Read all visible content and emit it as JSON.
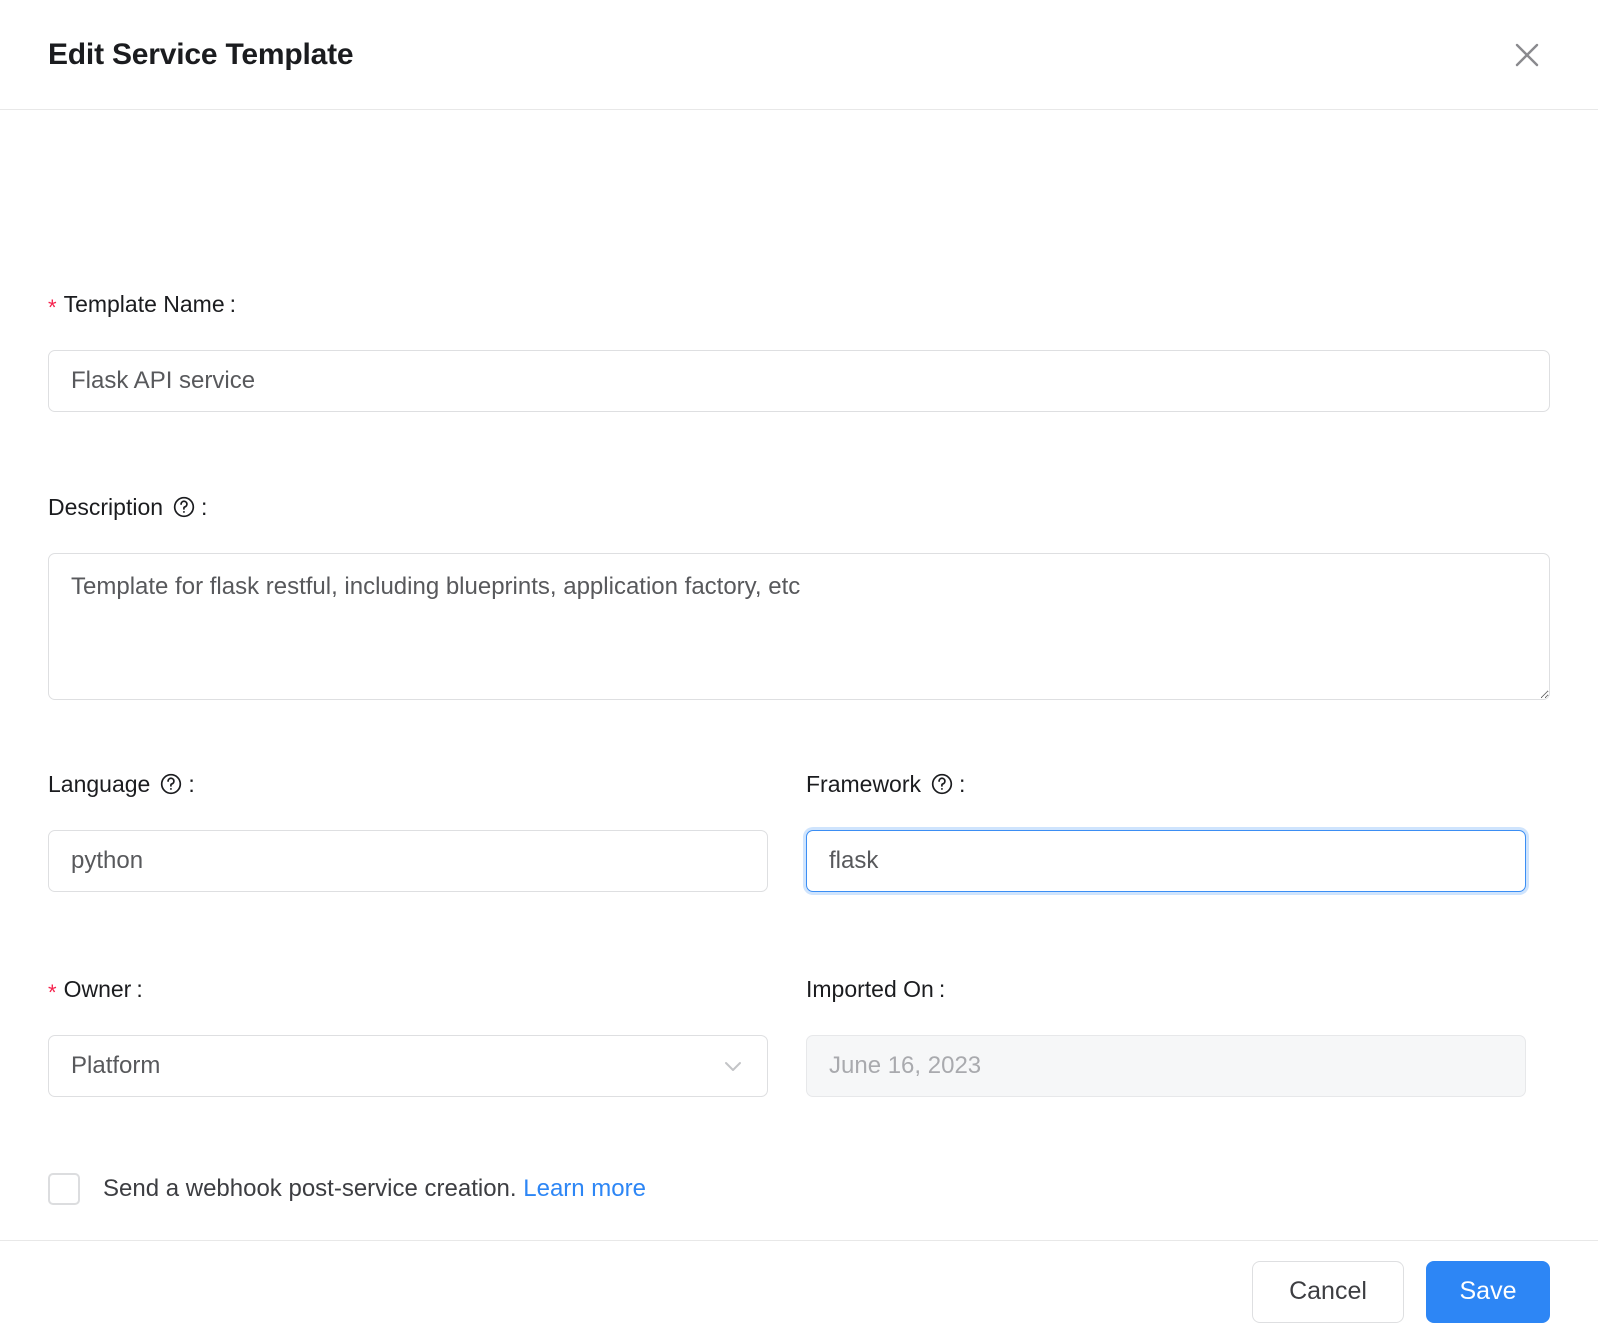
{
  "dialog": {
    "title": "Edit Service Template",
    "close_icon": "close-icon"
  },
  "fields": {
    "template_name": {
      "label": "Template Name",
      "required_marker": "*",
      "colon": ":",
      "value": "Flask API service"
    },
    "description": {
      "label": "Description",
      "help_icon": "question-circle-icon",
      "colon": ":",
      "value": "Template for flask restful, including blueprints, application factory, etc"
    },
    "language": {
      "label": "Language",
      "help_icon": "question-circle-icon",
      "colon": ":",
      "value": "python"
    },
    "framework": {
      "label": "Framework",
      "help_icon": "question-circle-icon",
      "colon": ":",
      "value": "flask",
      "focused": true
    },
    "owner": {
      "label": "Owner",
      "required_marker": "*",
      "colon": ":",
      "value": "Platform",
      "chevron_icon": "chevron-down-icon"
    },
    "imported_on": {
      "label": "Imported On",
      "colon": ":",
      "value": "June 16, 2023",
      "disabled": true
    }
  },
  "webhook": {
    "checked": false,
    "label": "Send a webhook post-service creation.",
    "link_label": "Learn more"
  },
  "footer": {
    "cancel_label": "Cancel",
    "save_label": "Save"
  },
  "colors": {
    "accent_blue": "#2d86f5",
    "focus_border": "#3b8ef4",
    "focus_ring": "#cfe4fd",
    "required_red": "#f5224d",
    "border_grey": "#dedfe1",
    "disabled_bg": "#f6f7f8"
  }
}
